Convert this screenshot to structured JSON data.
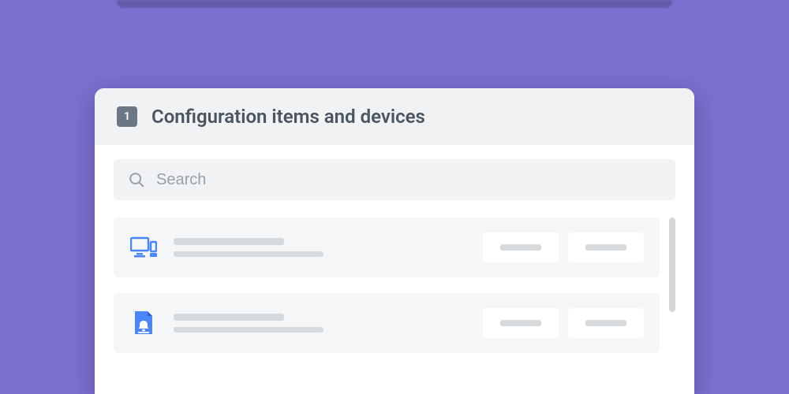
{
  "header": {
    "step_number": "1",
    "title": "Configuration items and devices"
  },
  "search": {
    "placeholder": "Search",
    "value": ""
  },
  "colors": {
    "background": "#7b6fd0",
    "icon_accent": "#4a86f7",
    "muted": "#9aa1a9"
  },
  "items": [
    {
      "icon": "desktop-computer-icon"
    },
    {
      "icon": "document-bell-icon"
    }
  ]
}
